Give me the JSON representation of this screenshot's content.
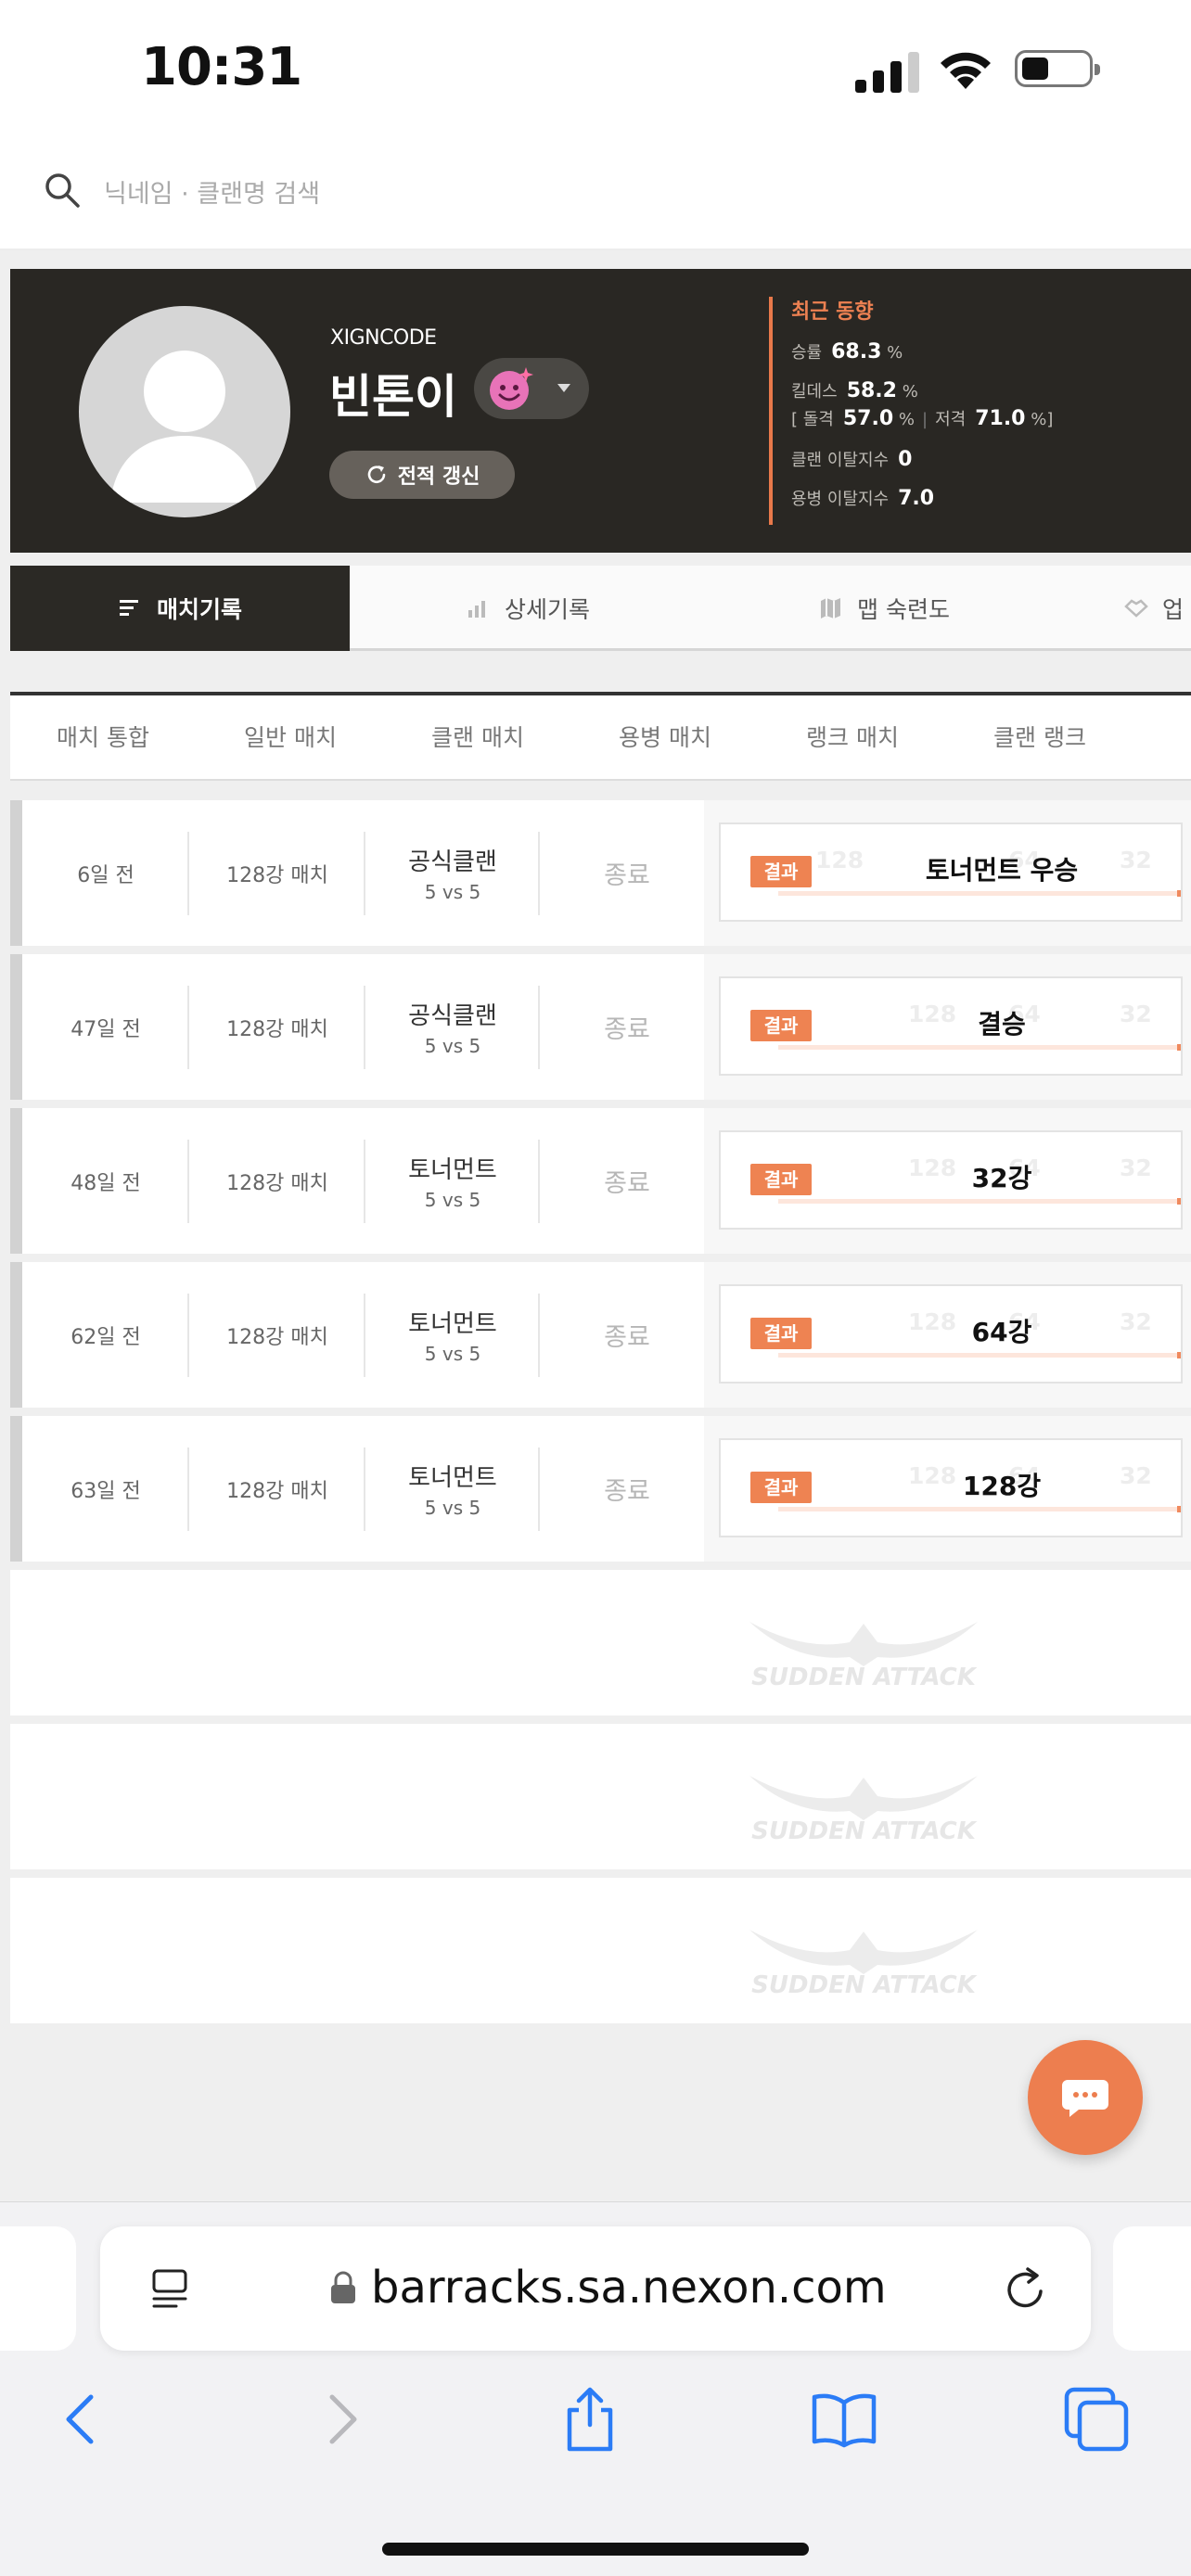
{
  "status": {
    "time": "10:31"
  },
  "search": {
    "placeholder": "닉네임 · 클랜명 검색"
  },
  "profile": {
    "clan": "XIGNCODE",
    "name": "빈톤이",
    "refresh_label": "전적 갱신",
    "stats_title": "최근 동향",
    "win_rate_label": "승률",
    "win_rate": "68.3",
    "pct": "%",
    "kd_label": "킬데스",
    "kd": "58.2",
    "assault_label": "돌격",
    "assault": "57.0",
    "sniper_label": "저격",
    "sniper": "71.0",
    "clan_leave_label": "클랜 이탈지수",
    "clan_leave": "0",
    "merc_leave_label": "용병 이탈지수",
    "merc_leave": "7.0"
  },
  "tabs": [
    {
      "label": "매치기록"
    },
    {
      "label": "상세기록"
    },
    {
      "label": "맵 숙련도"
    },
    {
      "label": "업"
    }
  ],
  "filters": [
    "매치 통합",
    "일반 매치",
    "클랜 매치",
    "용병 매치",
    "랭크 매치",
    "클랜 랭크"
  ],
  "matches": [
    {
      "date": "6일 전",
      "type": "128강 매치",
      "mode": "공식클랜",
      "size": "5 vs 5",
      "state": "종료",
      "badge": "결과",
      "result": "토너먼트 우승"
    },
    {
      "date": "47일 전",
      "type": "128강 매치",
      "mode": "공식클랜",
      "size": "5 vs 5",
      "state": "종료",
      "badge": "결과",
      "result": "결승"
    },
    {
      "date": "48일 전",
      "type": "128강 매치",
      "mode": "토너먼트",
      "size": "5 vs 5",
      "state": "종료",
      "badge": "결과",
      "result": "32강"
    },
    {
      "date": "62일 전",
      "type": "128강 매치",
      "mode": "토너먼트",
      "size": "5 vs 5",
      "state": "종료",
      "badge": "결과",
      "result": "64강"
    },
    {
      "date": "63일 전",
      "type": "128강 매치",
      "mode": "토너먼트",
      "size": "5 vs 5",
      "state": "종료",
      "badge": "결과",
      "result": "128강"
    }
  ],
  "bracket_ghost": {
    "a": "128",
    "b": "64",
    "c": "32"
  },
  "watermark": "SUDDEN ATTACK",
  "browser": {
    "url": "barracks.sa.nexon.com"
  },
  "colors": {
    "accent": "#ed7e4f",
    "dark": "#292723"
  }
}
